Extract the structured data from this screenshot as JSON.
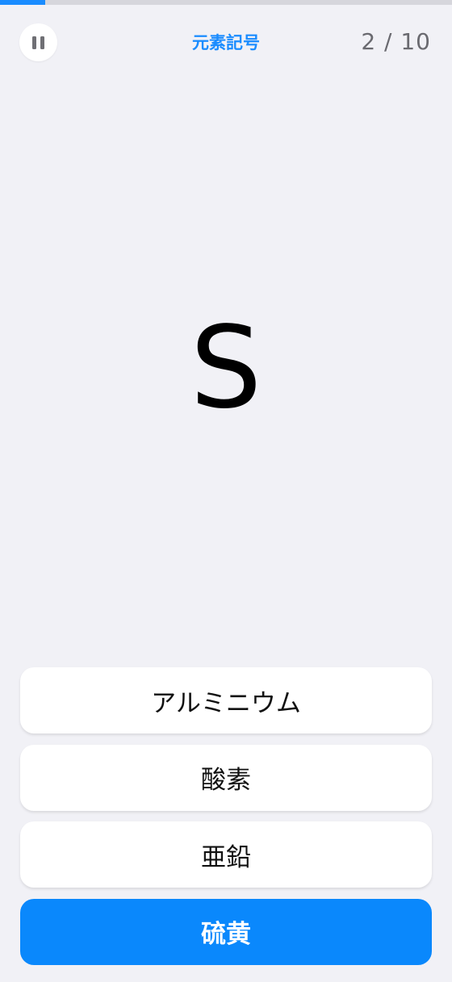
{
  "progress": {
    "current": 2,
    "total": 10,
    "fraction": 0.1
  },
  "header": {
    "title": "元素記号",
    "counter": "2 / 10"
  },
  "question": {
    "symbol": "S"
  },
  "choices": [
    {
      "label": "アルミニウム",
      "selected": false
    },
    {
      "label": "酸素",
      "selected": false
    },
    {
      "label": "亜鉛",
      "selected": false
    },
    {
      "label": "硫黄",
      "selected": true
    }
  ],
  "colors": {
    "accent": "#1a8cff",
    "selected_bg": "#0a88fc",
    "background": "#f1f1f6",
    "track": "#d6d6dc"
  },
  "icons": {
    "pause": "pause-icon"
  }
}
